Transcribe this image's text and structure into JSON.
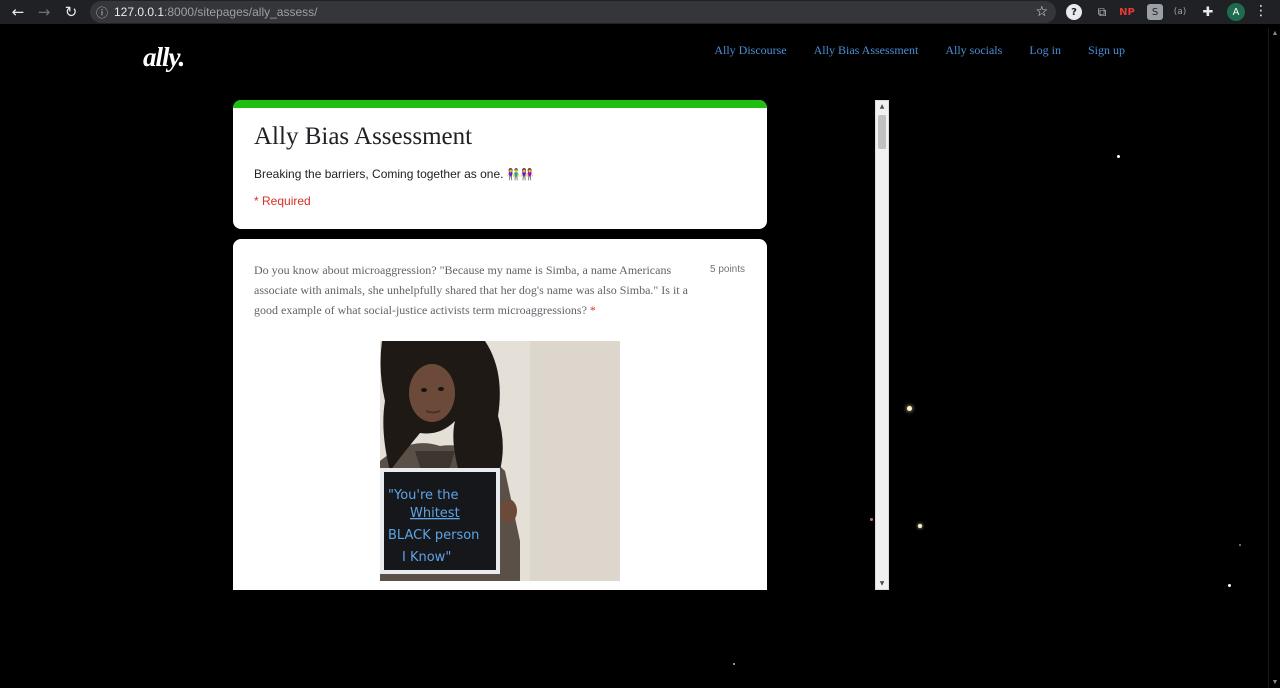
{
  "browser": {
    "url_host": "127.0.0.1",
    "url_rest": ":8000/sitepages/ally_assess/",
    "profile_initial": "A",
    "extensions": [
      "help-icon",
      "copy-icon",
      "NP",
      "s-icon",
      "(a)",
      "puzzle-icon"
    ]
  },
  "site": {
    "logo": "ally.",
    "nav": [
      {
        "label": "Ally Discourse"
      },
      {
        "label": "Ally Bias Assessment"
      },
      {
        "label": "Ally socials"
      },
      {
        "label": "Log in"
      },
      {
        "label": "Sign up"
      }
    ]
  },
  "form": {
    "title": "Ally Bias Assessment",
    "description": "Breaking the barriers, Coming together as one.",
    "required_note": "* Required",
    "accent_color": "#1fbf12"
  },
  "question": {
    "text": "Do you know about microaggression? \"Because my name is Simba, a name Americans associate with animals, she unhelpfully shared that her dog's name was also Simba.\" Is it a good example of what social-justice activists term microaggressions?",
    "required_mark": "*",
    "points": "5 points",
    "image_sign_lines": [
      "\"You're the",
      "Whitest",
      "BLACK person",
      "I Know\""
    ]
  }
}
